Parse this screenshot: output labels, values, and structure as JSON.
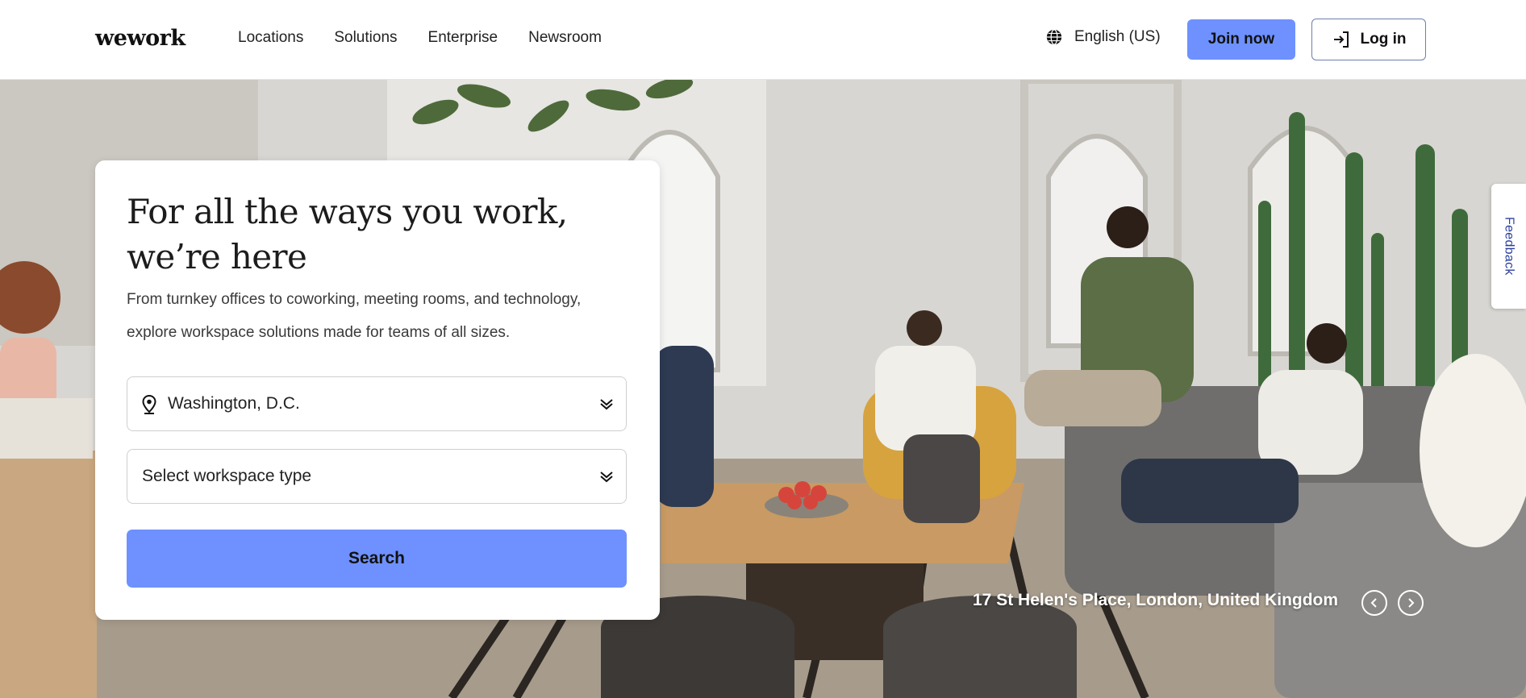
{
  "header": {
    "logo": "wework",
    "nav": [
      {
        "label": "Locations"
      },
      {
        "label": "Solutions"
      },
      {
        "label": "Enterprise"
      },
      {
        "label": "Newsroom"
      }
    ],
    "language": "English (US)",
    "join_label": "Join now",
    "login_label": "Log in"
  },
  "search_card": {
    "title": "For all the ways you work, we’re here",
    "description": "From turnkey offices to coworking, meeting rooms, and technology, explore workspace solutions made for teams of all sizes.",
    "location_value": "Washington, D.C.",
    "workspace_type_placeholder": "Select workspace type",
    "search_label": "Search"
  },
  "hero": {
    "caption": "17 St Helen's Place, London, United Kingdom"
  },
  "feedback_label": "Feedback",
  "colors": {
    "accent": "#6e91ff",
    "text": "#1a1a1a"
  }
}
